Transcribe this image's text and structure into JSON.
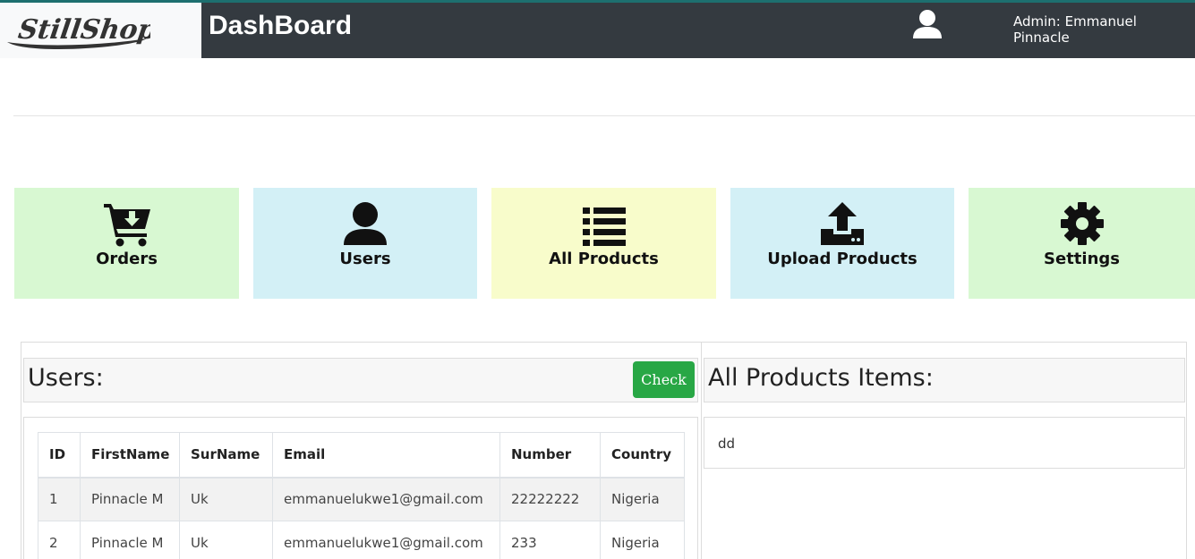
{
  "header": {
    "logo_text": "StillShop",
    "title": "DashBoard",
    "admin_label": "Admin: Emmanuel Pinnacle",
    "user_icon": "user-icon",
    "colors": {
      "bar": "#343a40",
      "accent": "#1d6f6f"
    }
  },
  "tiles": [
    {
      "label": "Orders",
      "icon": "cart-download-icon",
      "color": "#d8f8d2"
    },
    {
      "label": "Users",
      "icon": "user-icon",
      "color": "#d3f0f6"
    },
    {
      "label": "All Products",
      "icon": "list-icon",
      "color": "#f8fccb"
    },
    {
      "label": "Upload Products",
      "icon": "upload-icon",
      "color": "#d3f0f6"
    },
    {
      "label": "Settings",
      "icon": "gear-icon",
      "color": "#d8f8d2"
    }
  ],
  "users_panel": {
    "title": "Users:",
    "check_label": "Check",
    "columns": [
      "ID",
      "FirstName",
      "SurName",
      "Email",
      "Number",
      "Country"
    ],
    "rows": [
      [
        "1",
        "Pinnacle M",
        "Uk",
        "emmanuelukwe1@gmail.com",
        "22222222",
        "Nigeria"
      ],
      [
        "2",
        "Pinnacle M",
        "Uk",
        "emmanuelukwe1@gmail.com",
        "233",
        "Nigeria"
      ]
    ]
  },
  "products_panel": {
    "title": "All Products Items:",
    "body_text": "dd"
  }
}
